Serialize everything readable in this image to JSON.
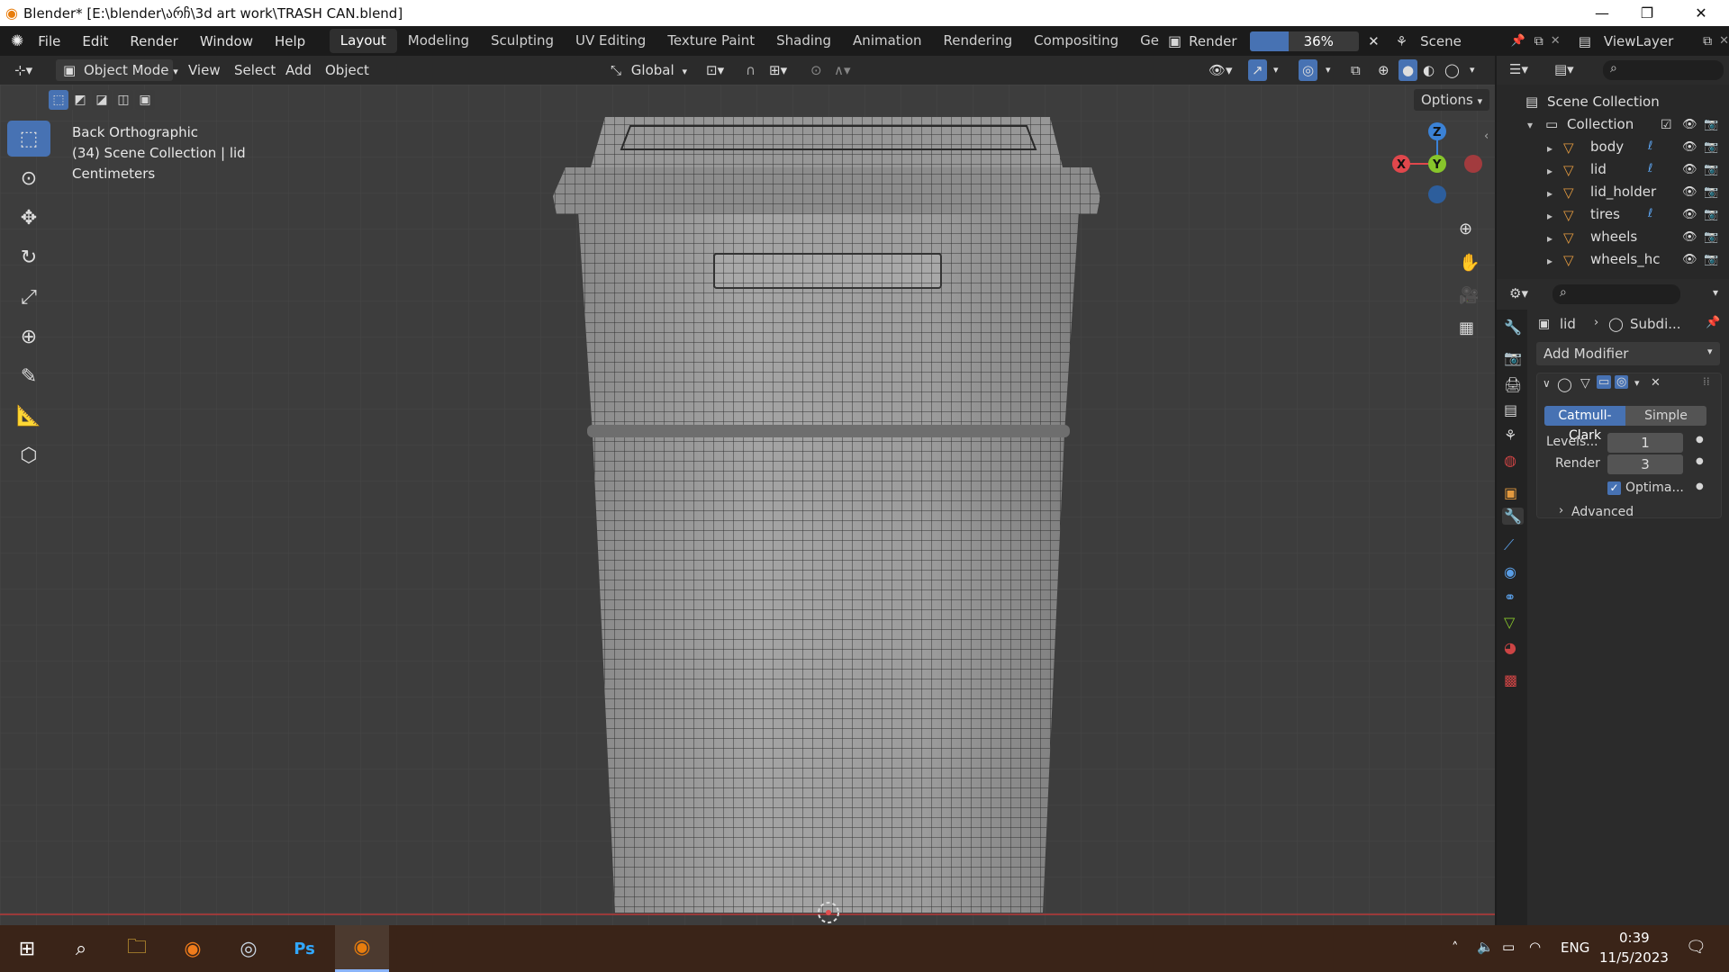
{
  "titlebar": {
    "title": "Blender* [E:\\blender\\არჩ\\3d art work\\TRASH CAN.blend]",
    "minimize": "—",
    "maximize": "❐",
    "close": "✕"
  },
  "menus": [
    "File",
    "Edit",
    "Render",
    "Window",
    "Help"
  ],
  "workspaces": [
    "Layout",
    "Modeling",
    "Sculpting",
    "UV Editing",
    "Texture Paint",
    "Shading",
    "Animation",
    "Rendering",
    "Compositing",
    "Ge"
  ],
  "active_workspace": "Layout",
  "render": {
    "label": "Render",
    "progress_text": "36%",
    "progress": 0.36
  },
  "scene": {
    "label": "Scene"
  },
  "view_layer": {
    "label": "ViewLayer"
  },
  "viewport_header": {
    "mode": "Object Mode",
    "view": "View",
    "select": "Select",
    "add": "Add",
    "object": "Object",
    "orientation": "Global",
    "options": "Options"
  },
  "viewport_info": {
    "view": "Back Orthographic",
    "collection": "(34) Scene Collection | lid",
    "units": "Centimeters"
  },
  "gizmo": {
    "z": "Z",
    "y": "Y",
    "x": "X"
  },
  "outliner": {
    "scene_collection": "Scene Collection",
    "collection": "Collection",
    "items": [
      {
        "name": "body"
      },
      {
        "name": "lid"
      },
      {
        "name": "lid_holder"
      },
      {
        "name": "tires"
      },
      {
        "name": "wheels"
      },
      {
        "name": "wheels_hc"
      }
    ]
  },
  "properties": {
    "breadcrumb_object": "lid",
    "breadcrumb_modifier": "Subdi...",
    "add_modifier": "Add Modifier",
    "catmull_clark": "Catmull-Clark",
    "simple": "Simple",
    "levels_label": "Levels...",
    "levels_value": "1",
    "render_label": "Render",
    "render_value": "3",
    "optimal_label": "Optima...",
    "advanced_label": "Advanced"
  },
  "taskbar": {
    "lang": "ENG",
    "time": "0:39",
    "date": "11/5/2023"
  },
  "colors": {
    "accent": "#4772b3",
    "viewport_bg": "#3d3d3d",
    "mesh": "#9a9a9a",
    "wire": "#303030",
    "taskbar": "#3a2418",
    "x_axis": "#e0474c",
    "y_axis": "#87c52b",
    "z_axis": "#3b82d6"
  }
}
